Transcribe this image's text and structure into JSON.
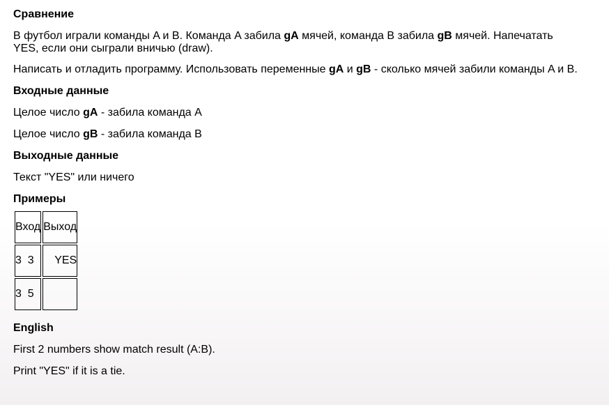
{
  "task": {
    "title": "Сравнение",
    "p1": [
      "В футбол играли команды A и B. Команда A забила ",
      "gA",
      " мячей, команда B забила ",
      "gB",
      " мячей. Напечатать YES, если они сыграли вничью (draw)."
    ],
    "p2": [
      "Написать и отладить программу. Использовать переменные ",
      "gA",
      " и ",
      "gB",
      " - сколько мячей забили команды A и B."
    ]
  },
  "input": {
    "heading": "Входные данные",
    "line1": [
      "Целое число ",
      "gA",
      " - забила команда A"
    ],
    "line2": [
      "Целое число ",
      "gB",
      " - забила команда B"
    ]
  },
  "output": {
    "heading": "Выходные данные",
    "line1": "Текст \"YES\" или ничего"
  },
  "examples": {
    "heading": "Примеры",
    "col_in": "Вход",
    "col_out": "Выход",
    "rows": [
      {
        "in": "3  3",
        "out": "YES"
      },
      {
        "in": "3  5",
        "out": ""
      }
    ]
  },
  "english": {
    "heading": "English",
    "line1": "First 2 numbers show match result (A:B).",
    "line2": "Print \"YES\" if it is a tie."
  }
}
